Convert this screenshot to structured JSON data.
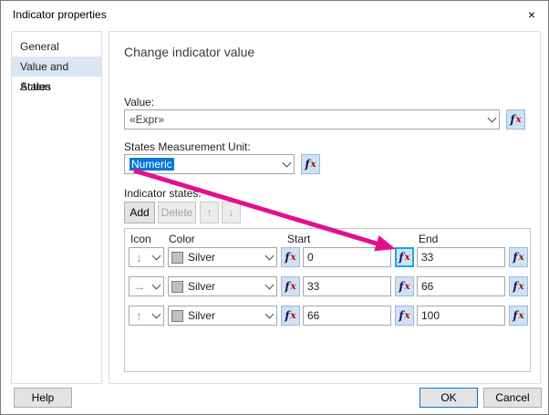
{
  "colors": {
    "annotation_arrow": "#e40f8b",
    "selection": "#0078d7",
    "fx_highlight": "#19a8e6"
  },
  "dialog": {
    "title": "Indicator properties"
  },
  "icons": {
    "close": "×",
    "fx_f": "f",
    "fx_x": "x",
    "move_up": "↑",
    "move_down": "↓"
  },
  "sidebar": {
    "items": [
      {
        "label": "General"
      },
      {
        "label": "Value and States"
      },
      {
        "label": "Action"
      }
    ]
  },
  "main": {
    "heading": "Change indicator value",
    "value": {
      "label": "Value:",
      "current": "«Expr»"
    },
    "unit": {
      "label": "States Measurement Unit:",
      "current": "Numeric"
    },
    "states": {
      "label": "Indicator states:",
      "add": "Add",
      "delete": "Delete",
      "headers": {
        "icon": "Icon",
        "color": "Color",
        "start": "Start",
        "end": "End"
      },
      "rows": [
        {
          "icon": "down-arrow",
          "glyph": "↓",
          "color": "Silver",
          "start": "0",
          "end": "33"
        },
        {
          "icon": "right-arrow",
          "glyph": "→",
          "color": "Silver",
          "start": "33",
          "end": "66"
        },
        {
          "icon": "up-arrow",
          "glyph": "↑",
          "color": "Silver",
          "start": "66",
          "end": "100"
        }
      ]
    }
  },
  "footer": {
    "help": "Help",
    "ok": "OK",
    "cancel": "Cancel"
  }
}
